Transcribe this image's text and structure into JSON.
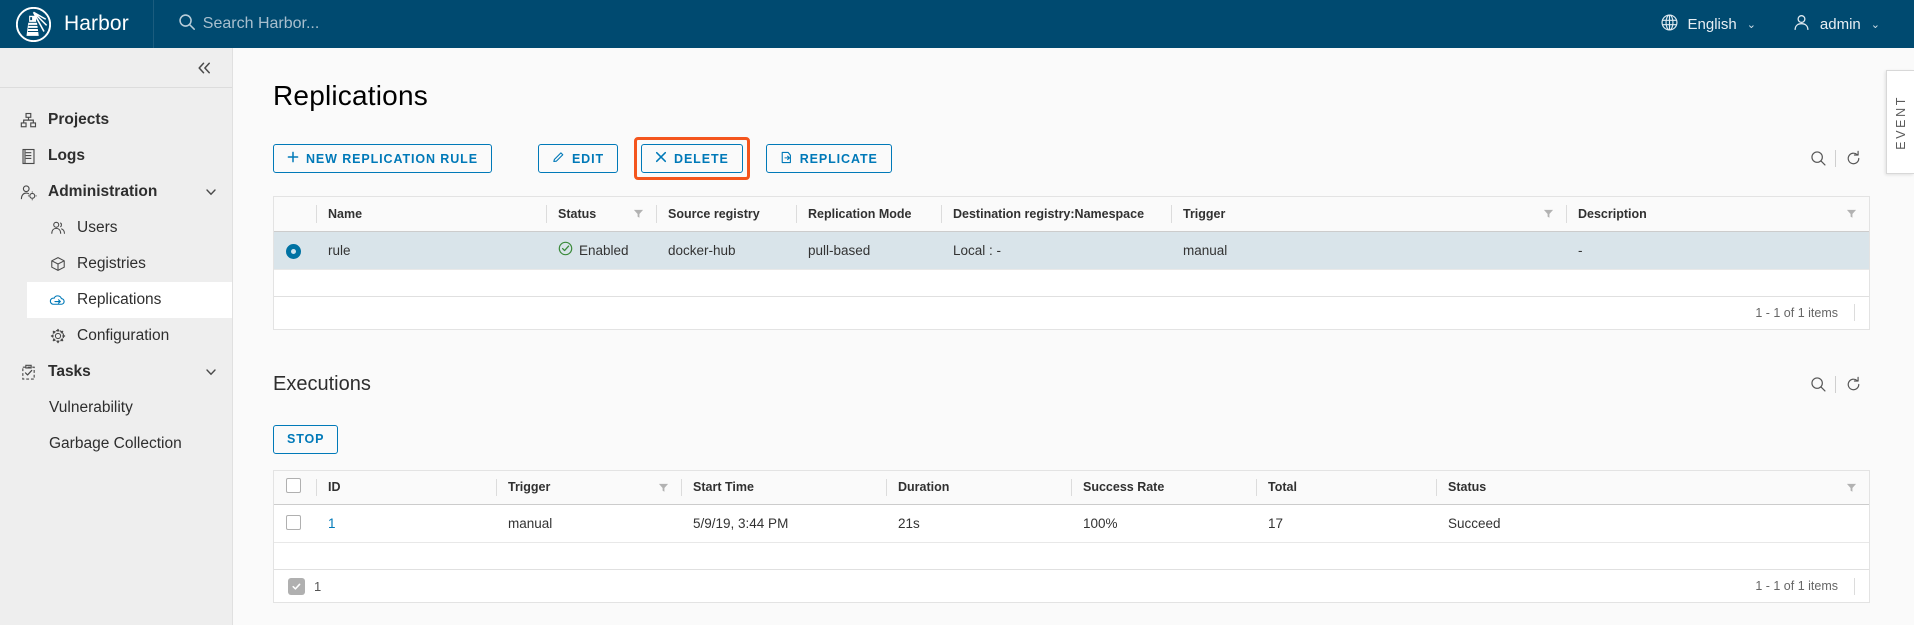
{
  "header": {
    "brand": "Harbor",
    "logo_icon": "harbor-lighthouse-logo",
    "search_icon": "search-icon",
    "search_placeholder": "Search Harbor...",
    "search_value": "",
    "language": {
      "label": "English",
      "icon": "globe-icon",
      "caret": "⌄"
    },
    "user": {
      "label": "admin",
      "icon": "user-icon",
      "caret": "⌄"
    }
  },
  "sidebar": {
    "collapse_icon": "double-chevron-left-icon",
    "items": [
      {
        "label": "Projects",
        "icon": "projects-icon",
        "level": 0,
        "bold": true,
        "active": false,
        "expandable": false
      },
      {
        "label": "Logs",
        "icon": "logs-icon",
        "level": 0,
        "bold": true,
        "active": false,
        "expandable": false
      },
      {
        "label": "Administration",
        "icon": "administration-icon",
        "level": 0,
        "bold": true,
        "active": false,
        "expandable": true
      },
      {
        "label": "Users",
        "icon": "users-icon",
        "level": 1,
        "bold": false,
        "active": false,
        "expandable": false
      },
      {
        "label": "Registries",
        "icon": "registries-icon",
        "level": 1,
        "bold": false,
        "active": false,
        "expandable": false
      },
      {
        "label": "Replications",
        "icon": "replications-icon",
        "level": 1,
        "bold": false,
        "active": true,
        "expandable": false
      },
      {
        "label": "Configuration",
        "icon": "configuration-gear-icon",
        "level": 1,
        "bold": false,
        "active": false,
        "expandable": false
      },
      {
        "label": "Tasks",
        "icon": "tasks-icon",
        "level": 0,
        "bold": true,
        "active": false,
        "expandable": true
      },
      {
        "label": "Vulnerability",
        "icon": "",
        "level": 1,
        "bold": false,
        "active": false,
        "expandable": false
      },
      {
        "label": "Garbage Collection",
        "icon": "",
        "level": 1,
        "bold": false,
        "active": false,
        "expandable": false
      }
    ]
  },
  "main": {
    "page_title": "Replications",
    "toolbar": {
      "new_rule_label": "NEW REPLICATION RULE",
      "new_rule_icon": "plus-icon",
      "edit_label": "EDIT",
      "edit_icon": "pencil-icon",
      "delete_label": "DELETE",
      "delete_icon": "close-x-icon",
      "delete_highlighted": true,
      "highlight_color": "#f4551d",
      "replicate_label": "REPLICATE",
      "replicate_icon": "export-icon",
      "search_icon": "search-icon",
      "refresh_icon": "refresh-icon"
    },
    "rules_table": {
      "columns": [
        {
          "label": "Name",
          "filter": false
        },
        {
          "label": "Status",
          "filter": true
        },
        {
          "label": "Source registry",
          "filter": false
        },
        {
          "label": "Replication Mode",
          "filter": false
        },
        {
          "label": "Destination registry:Namespace",
          "filter": false
        },
        {
          "label": "Trigger",
          "filter": true
        },
        {
          "label": "Description",
          "filter": true
        }
      ],
      "rows": [
        {
          "selected": true,
          "name": "rule",
          "status": "Enabled",
          "status_icon": "check-circle-icon",
          "status_color": "#3a8a3a",
          "source_registry": "docker-hub",
          "replication_mode": "pull-based",
          "destination": "Local : -",
          "trigger": "manual",
          "description": "-"
        }
      ],
      "footer_count": "1 - 1 of 1 items"
    },
    "executions": {
      "title": "Executions",
      "search_icon": "search-icon",
      "refresh_icon": "refresh-icon",
      "stop_label": "STOP",
      "columns": [
        {
          "label": "ID",
          "filter": false
        },
        {
          "label": "Trigger",
          "filter": true
        },
        {
          "label": "Start Time",
          "filter": false
        },
        {
          "label": "Duration",
          "filter": false
        },
        {
          "label": "Success Rate",
          "filter": false
        },
        {
          "label": "Total",
          "filter": false
        },
        {
          "label": "Status",
          "filter": true
        }
      ],
      "rows": [
        {
          "id": "1",
          "trigger": "manual",
          "start_time": "5/9/19, 3:44 PM",
          "duration": "21s",
          "success_rate": "100%",
          "total": "17",
          "status": "Succeed"
        }
      ],
      "footer_selected_count": "1",
      "footer_count": "1 - 1 of 1 items"
    },
    "event_tab": {
      "label": "EVENT"
    }
  }
}
